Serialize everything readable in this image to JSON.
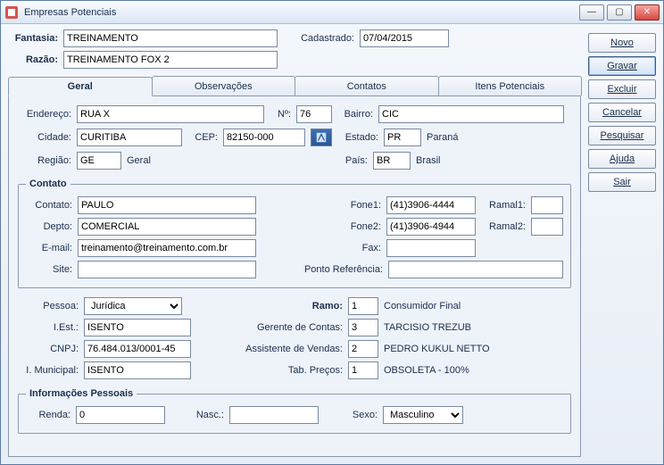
{
  "window": {
    "title": "Empresas Potenciais"
  },
  "sidebar": {
    "novo": "Novo",
    "gravar": "Gravar",
    "excluir": "Excluir",
    "cancelar": "Cancelar",
    "pesquisar": "Pesquisar",
    "ajuda": "Ajuda",
    "sair": "Sair"
  },
  "header": {
    "fantasia_label": "Fantasia:",
    "fantasia": "TREINAMENTO",
    "cadastrado_label": "Cadastrado:",
    "cadastrado": "07/04/2015",
    "razao_label": "Razão:",
    "razao": "TREINAMENTO FOX 2"
  },
  "tabs": {
    "geral": "Geral",
    "observacoes": "Observações",
    "contatos": "Contatos",
    "itens": "Itens Potenciais"
  },
  "geral": {
    "endereco_label": "Endereço:",
    "endereco": "RUA X",
    "numero_label": "Nº:",
    "numero": "76",
    "bairro_label": "Bairro:",
    "bairro": "CIC",
    "cidade_label": "Cidade:",
    "cidade": "CURITIBA",
    "cep_label": "CEP:",
    "cep": "82150-000",
    "estado_label": "Estado:",
    "estado": "PR",
    "estado_nome": "Paraná",
    "regiao_label": "Região:",
    "regiao": "GE",
    "regiao_nome": "Geral",
    "pais_label": "País:",
    "pais": "BR",
    "pais_nome": "Brasil"
  },
  "contato_group": {
    "legend": "Contato",
    "contato_label": "Contato:",
    "contato": "PAULO",
    "fone1_label": "Fone1:",
    "fone1": "(41)3906-4444",
    "ramal1_label": "Ramal1:",
    "ramal1": "",
    "depto_label": "Depto:",
    "depto": "COMERCIAL",
    "fone2_label": "Fone2:",
    "fone2": "(41)3906-4944",
    "ramal2_label": "Ramal2:",
    "ramal2": "",
    "email_label": "E-mail:",
    "email": "treinamento@treinamento.com.br",
    "fax_label": "Fax:",
    "fax": "",
    "site_label": "Site:",
    "site": "",
    "ponto_label": "Ponto Referência:",
    "ponto": ""
  },
  "fiscal": {
    "pessoa_label": "Pessoa:",
    "pessoa": "Jurídica",
    "iest_label": "I.Est.:",
    "iest": "ISENTO",
    "cnpj_label": "CNPJ:",
    "cnpj": "76.484.013/0001-45",
    "imun_label": "I. Municipal:",
    "imun": "ISENTO",
    "ramo_label": "Ramo:",
    "ramo": "1",
    "ramo_nome": "Consumidor Final",
    "gerente_label": "Gerente de Contas:",
    "gerente": "3",
    "gerente_nome": "TARCISIO TREZUB",
    "assist_label": "Assistente de Vendas:",
    "assist": "2",
    "assist_nome": "PEDRO KUKUL NETTO",
    "tabprecos_label": "Tab. Preços:",
    "tabprecos": "1",
    "tabprecos_nome": "OBSOLETA - 100%"
  },
  "pessoais": {
    "legend": "Informações Pessoais",
    "renda_label": "Renda:",
    "renda": "0",
    "nasc_label": "Nasc.:",
    "nasc": "",
    "sexo_label": "Sexo:",
    "sexo": "Masculino"
  }
}
